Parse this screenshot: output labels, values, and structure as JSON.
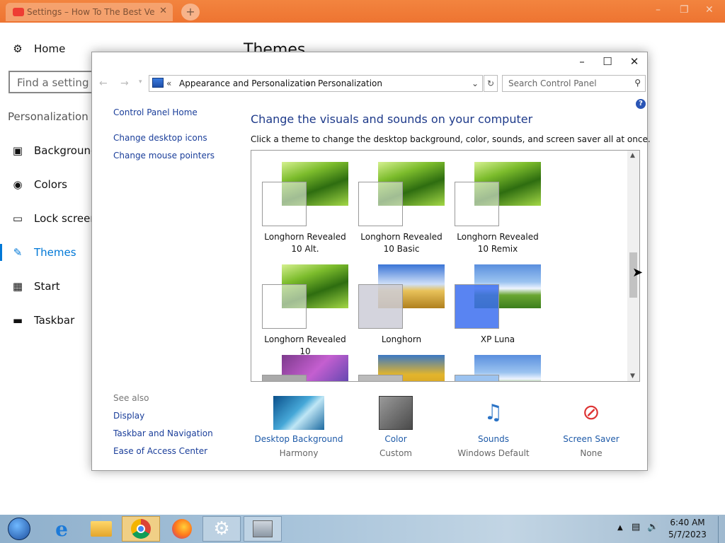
{
  "browser": {
    "tab_title": "Settings – How To The Best Ver",
    "tab_close": "✕",
    "new_tab": "+"
  },
  "settings": {
    "home": "Home",
    "search_placeholder": "Find a setting",
    "section": "Personalization",
    "nav": [
      {
        "label": "Background",
        "icon": "image-icon"
      },
      {
        "label": "Colors",
        "icon": "palette-icon"
      },
      {
        "label": "Lock screen",
        "icon": "monitor-icon"
      },
      {
        "label": "Themes",
        "icon": "brush-icon",
        "selected": true
      },
      {
        "label": "Start",
        "icon": "grid-icon"
      },
      {
        "label": "Taskbar",
        "icon": "taskbar-icon"
      }
    ],
    "page_title": "Themes"
  },
  "control_panel": {
    "breadcrumb": [
      "Appearance and Personalization",
      "Personalization"
    ],
    "search_placeholder": "Search Control Panel",
    "sidebar": {
      "home_link": "Control Panel Home",
      "links": [
        "Change desktop icons",
        "Change mouse pointers"
      ],
      "see_also_label": "See also",
      "see_also": [
        "Display",
        "Taskbar and Navigation",
        "Ease of Access Center"
      ]
    },
    "title": "Change the visuals and sounds on your computer",
    "description": "Click a theme to change the desktop background, color, sounds, and screen saver all at once.",
    "themes": [
      {
        "name": "Longhorn Revealed 10 Alt."
      },
      {
        "name": "Longhorn Revealed 10 Basic"
      },
      {
        "name": "Longhorn Revealed 10 Remix"
      },
      {
        "name": "Longhorn Revealed 10"
      },
      {
        "name": "Longhorn"
      },
      {
        "name": "XP Luna"
      }
    ],
    "bottom": [
      {
        "name": "Desktop Background",
        "value": "Harmony"
      },
      {
        "name": "Color",
        "value": "Custom"
      },
      {
        "name": "Sounds",
        "value": "Windows Default"
      },
      {
        "name": "Screen Saver",
        "value": "None"
      }
    ]
  },
  "taskbar": {
    "time": "6:40 AM",
    "date": "5/7/2023"
  }
}
